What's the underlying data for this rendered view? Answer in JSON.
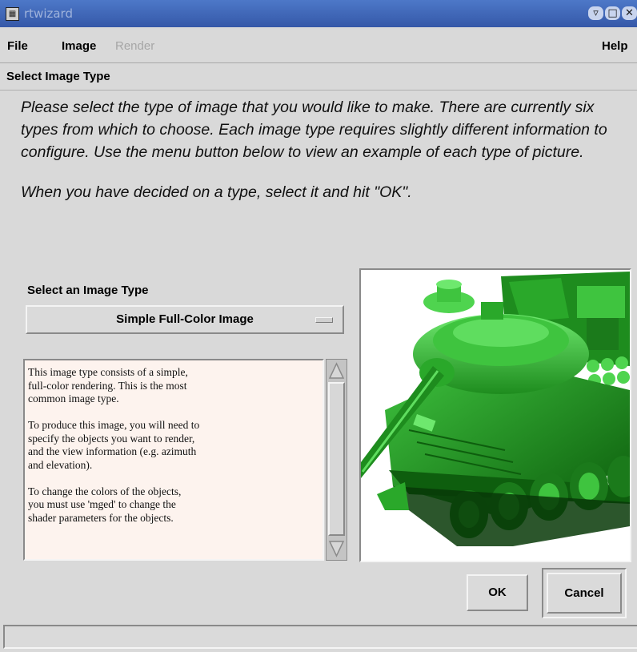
{
  "window": {
    "title": "rtwizard",
    "controls": [
      "minimize-icon",
      "maximize-icon",
      "close-icon"
    ]
  },
  "menubar": {
    "items": [
      {
        "label": "File",
        "enabled": true
      },
      {
        "label": "Image",
        "enabled": true
      },
      {
        "label": "Render",
        "enabled": false
      }
    ],
    "help": "Help"
  },
  "section": {
    "title": "Select Image Type"
  },
  "instructions": {
    "paragraph1": "Please select the type of image that you would like to make. There are currently six types from which to choose. Each image type requires slightly different information to configure. Use the menu button below to view an example of each type of picture.",
    "paragraph2": "When you have decided on a type, select it and hit \"OK\"."
  },
  "selector": {
    "label": "Select an Image Type",
    "value": "Simple Full-Color Image"
  },
  "description": {
    "paragraphs": [
      "This image type consists of a simple,\nfull-color rendering. This is the most\ncommon image type.",
      "To produce this image, you will need to\nspecify the objects you want to render,\nand the view information (e.g. azimuth\nand elevation).",
      "To change the colors of the objects,\nyou must use 'mged' to change the\nshader parameters for the objects."
    ]
  },
  "preview": {
    "subject": "green-tank-render",
    "colors": {
      "dark": "#0b4a0b",
      "mid": "#1e8c1e",
      "light": "#3fc43f",
      "highlight": "#6ee86e"
    }
  },
  "buttons": {
    "ok": "OK",
    "cancel": "Cancel"
  },
  "status": {
    "text": ""
  }
}
